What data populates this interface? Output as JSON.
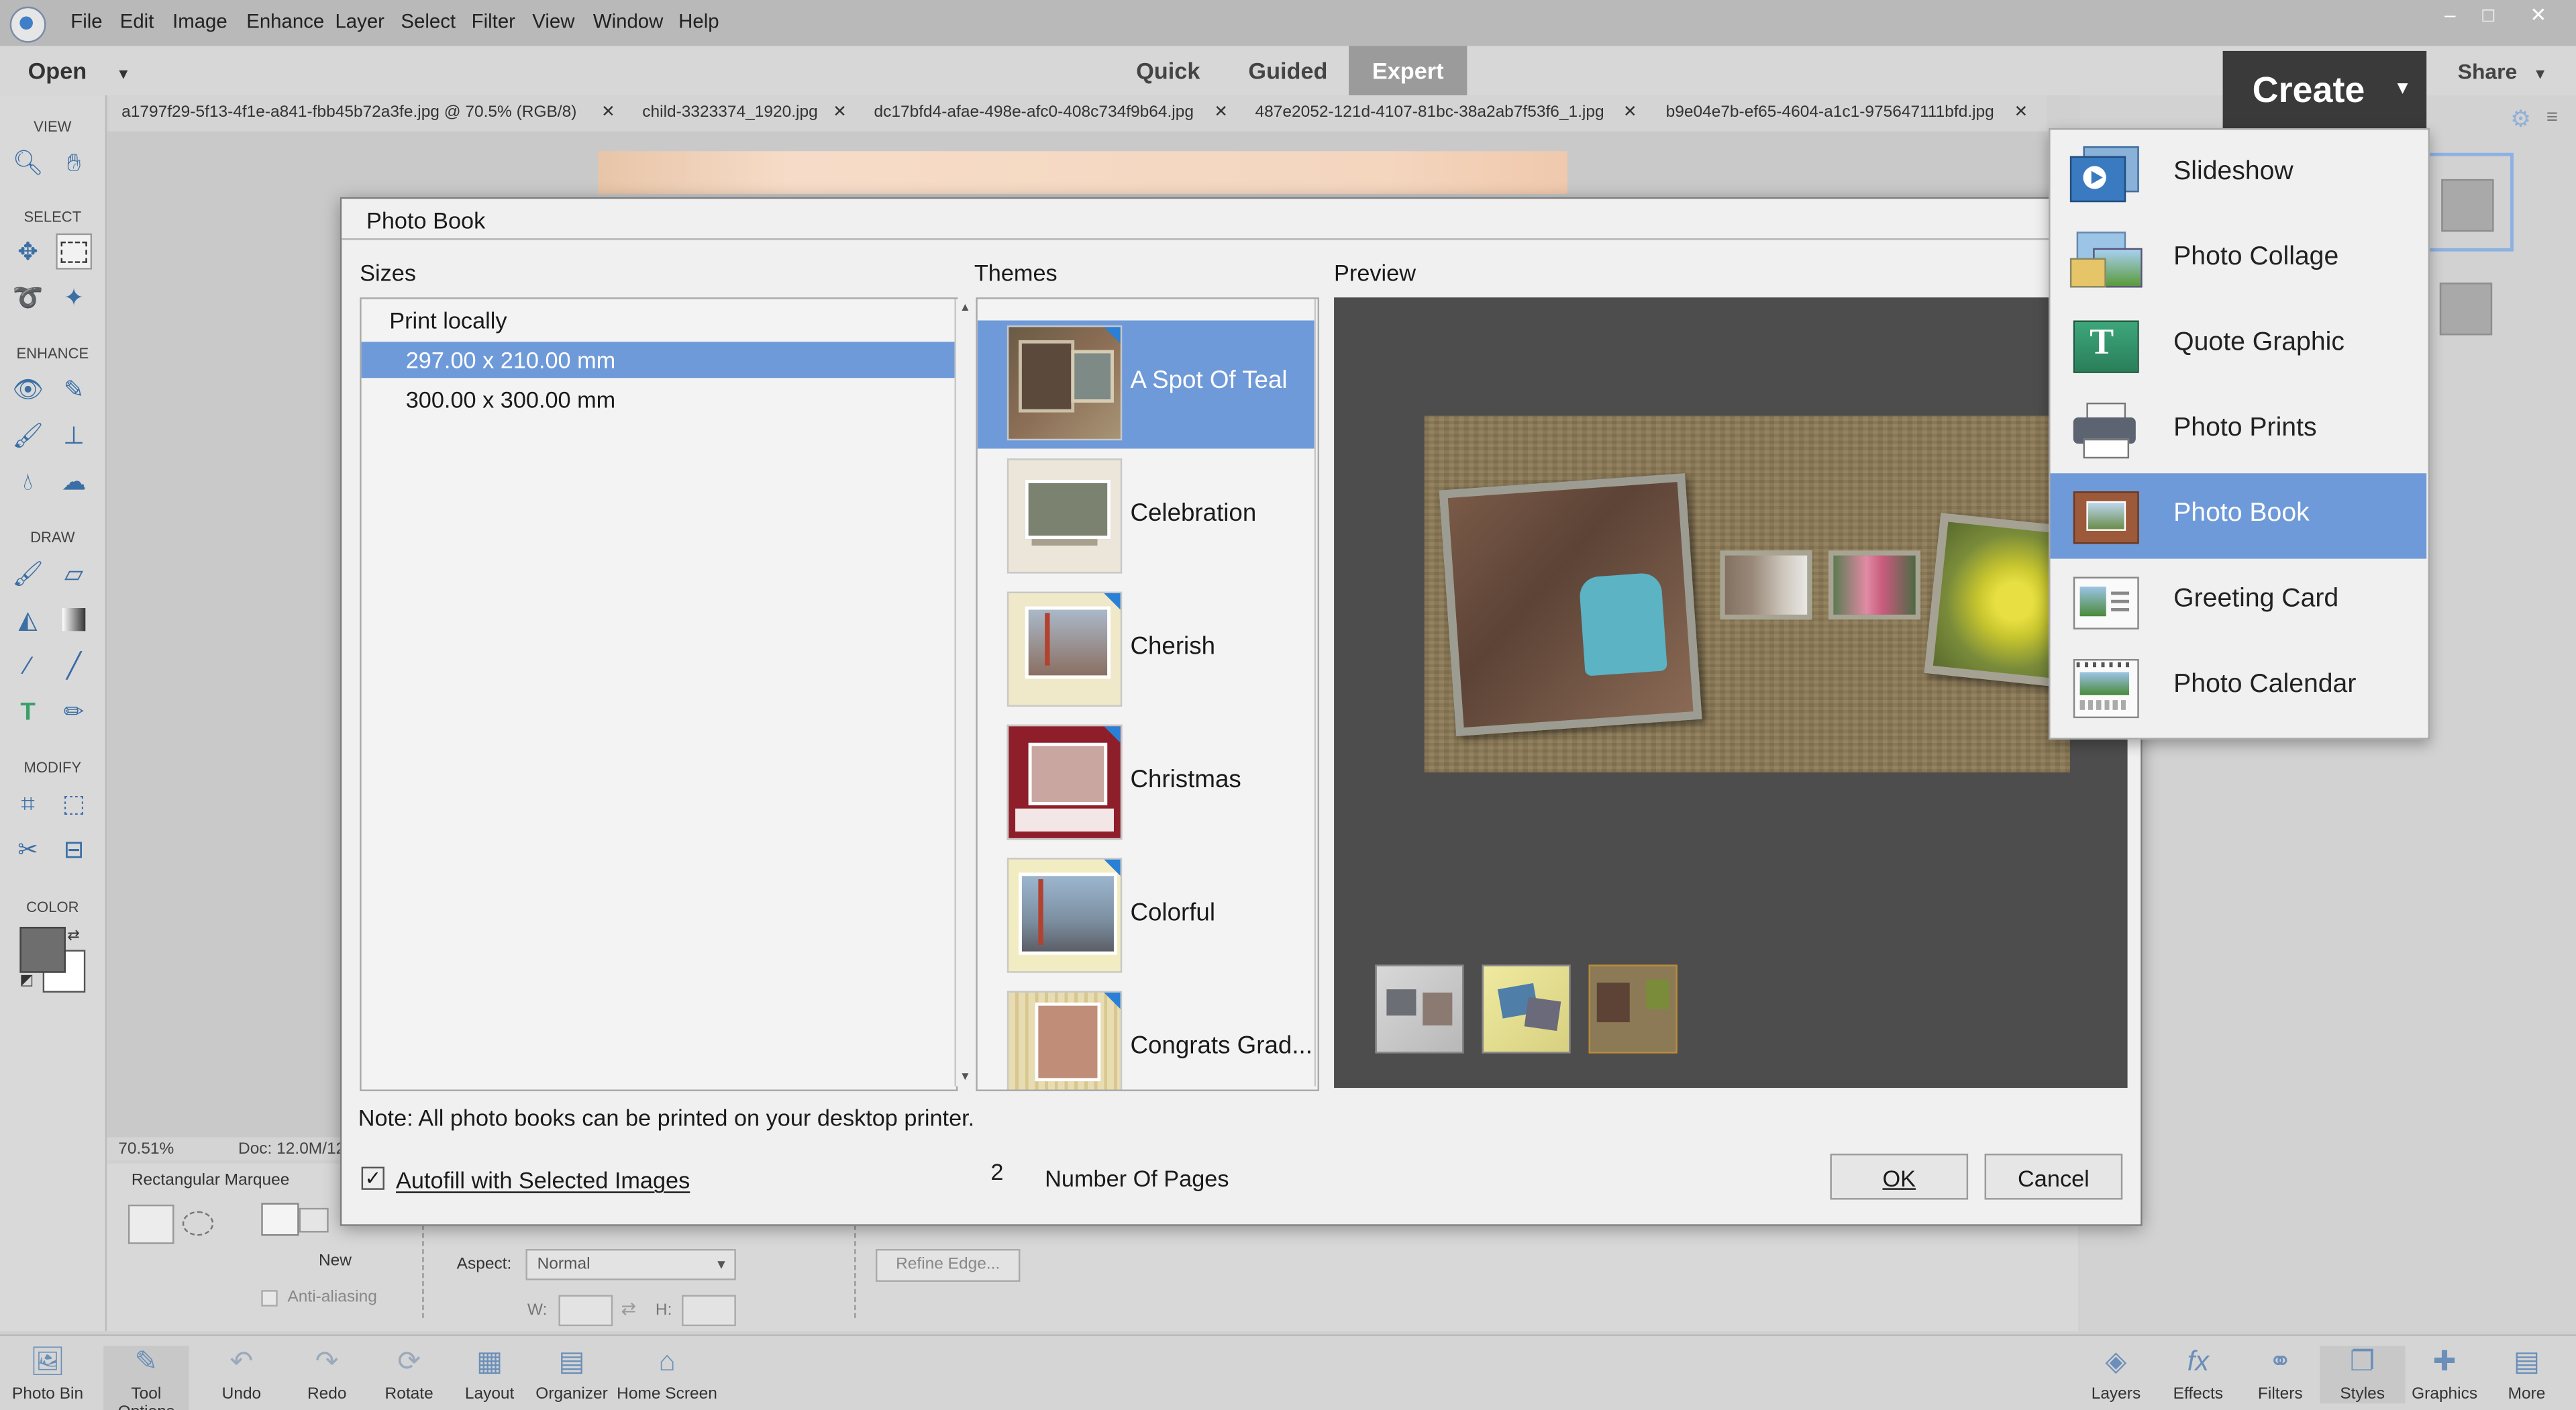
{
  "menubar": {
    "items": [
      "File",
      "Edit",
      "Image",
      "Enhance",
      "Layer",
      "Select",
      "Filter",
      "View",
      "Window",
      "Help"
    ],
    "window_controls": [
      "–",
      "□",
      "✕"
    ]
  },
  "modebar": {
    "open_label": "Open",
    "tabs": [
      "Quick",
      "Guided",
      "Expert"
    ],
    "active_tab": "Expert",
    "share_label": "Share"
  },
  "doc_tabs": [
    "a1797f29-5f13-4f1e-a841-fbb45b72a3fe.jpg @ 70.5% (RGB/8)",
    "child-3323374_1920.jpg",
    "dc17bfd4-afae-498e-afc0-408c734f9b64.jpg",
    "487e2052-121d-4107-81bc-38a2ab7f53f6_1.jpg",
    "b9e04e7b-ef65-4604-a1c1-975647111bfd.jpg"
  ],
  "toolbox": {
    "sections": [
      "VIEW",
      "SELECT",
      "ENHANCE",
      "DRAW",
      "MODIFY",
      "COLOR"
    ]
  },
  "status": {
    "zoom": "70.51%",
    "doc": "Doc: 12.0M/12"
  },
  "tool_options": {
    "tool_name": "Rectangular Marquee",
    "new_label": "New",
    "antialias_label": "Anti-aliasing",
    "aspect_label": "Aspect:",
    "aspect_value": "Normal",
    "w_label": "W:",
    "h_label": "H:",
    "refine_label": "Refine Edge..."
  },
  "bottombar": {
    "left": [
      "Photo Bin",
      "Tool Options",
      "Undo",
      "Redo",
      "Rotate",
      "Layout",
      "Organizer",
      "Home Screen"
    ],
    "right": [
      "Layers",
      "Effects",
      "Filters",
      "Styles",
      "Graphics",
      "More"
    ]
  },
  "dialog": {
    "title": "Photo Book",
    "sizes_header": "Sizes",
    "themes_header": "Themes",
    "preview_header": "Preview",
    "sizes": [
      "Print locally",
      "297.00 x 210.00 mm",
      "300.00 x 300.00 mm"
    ],
    "themes": [
      "A Spot Of Teal",
      "Celebration",
      "Cherish",
      "Christmas",
      "Colorful",
      "Congrats Grad..."
    ],
    "note": "Note: All photo books can be printed on your desktop printer.",
    "autofill_label": "Autofill with Selected Images",
    "autofill_checked": true,
    "pages_value": "2",
    "pages_label": "Number Of Pages",
    "ok_label": "OK",
    "cancel_label": "Cancel"
  },
  "create": {
    "button_label": "Create",
    "items": [
      "Slideshow",
      "Photo Collage",
      "Quote Graphic",
      "Photo Prints",
      "Photo Book",
      "Greeting Card",
      "Photo Calendar"
    ],
    "selected": "Photo Book"
  },
  "colors": {
    "accent": "#6f9ad9",
    "create_bg": "#3a3a3a",
    "preview_bg": "#4d4d4d"
  }
}
